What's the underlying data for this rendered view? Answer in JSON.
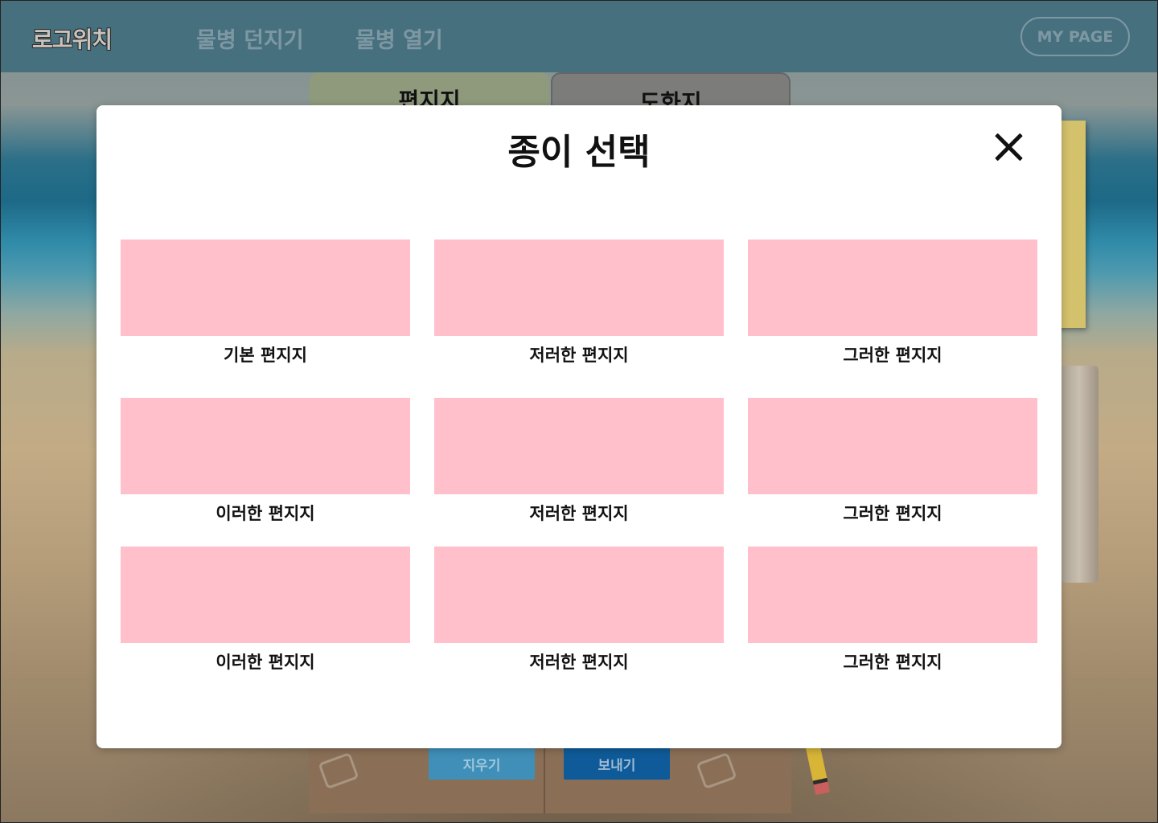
{
  "header": {
    "logo": "로고위치",
    "nav": [
      "물병 던지기",
      "물병 열기"
    ],
    "mypage_label": "MY PAGE"
  },
  "background": {
    "tabs": [
      "편지지",
      "도화지"
    ],
    "buttons": {
      "erase": "지우기",
      "send": "보내기"
    }
  },
  "modal": {
    "title": "종이 선택",
    "close_icon": "close-icon",
    "swatch_color": "#ffc0cb",
    "papers": [
      {
        "label": "기본 편지지"
      },
      {
        "label": "저러한 편지지"
      },
      {
        "label": "그러한 편지지"
      },
      {
        "label": "이러한 편지지"
      },
      {
        "label": "저러한 편지지"
      },
      {
        "label": "그러한 편지지"
      },
      {
        "label": "이러한 편지지"
      },
      {
        "label": "저러한 편지지"
      },
      {
        "label": "그러한 편지지"
      }
    ]
  }
}
